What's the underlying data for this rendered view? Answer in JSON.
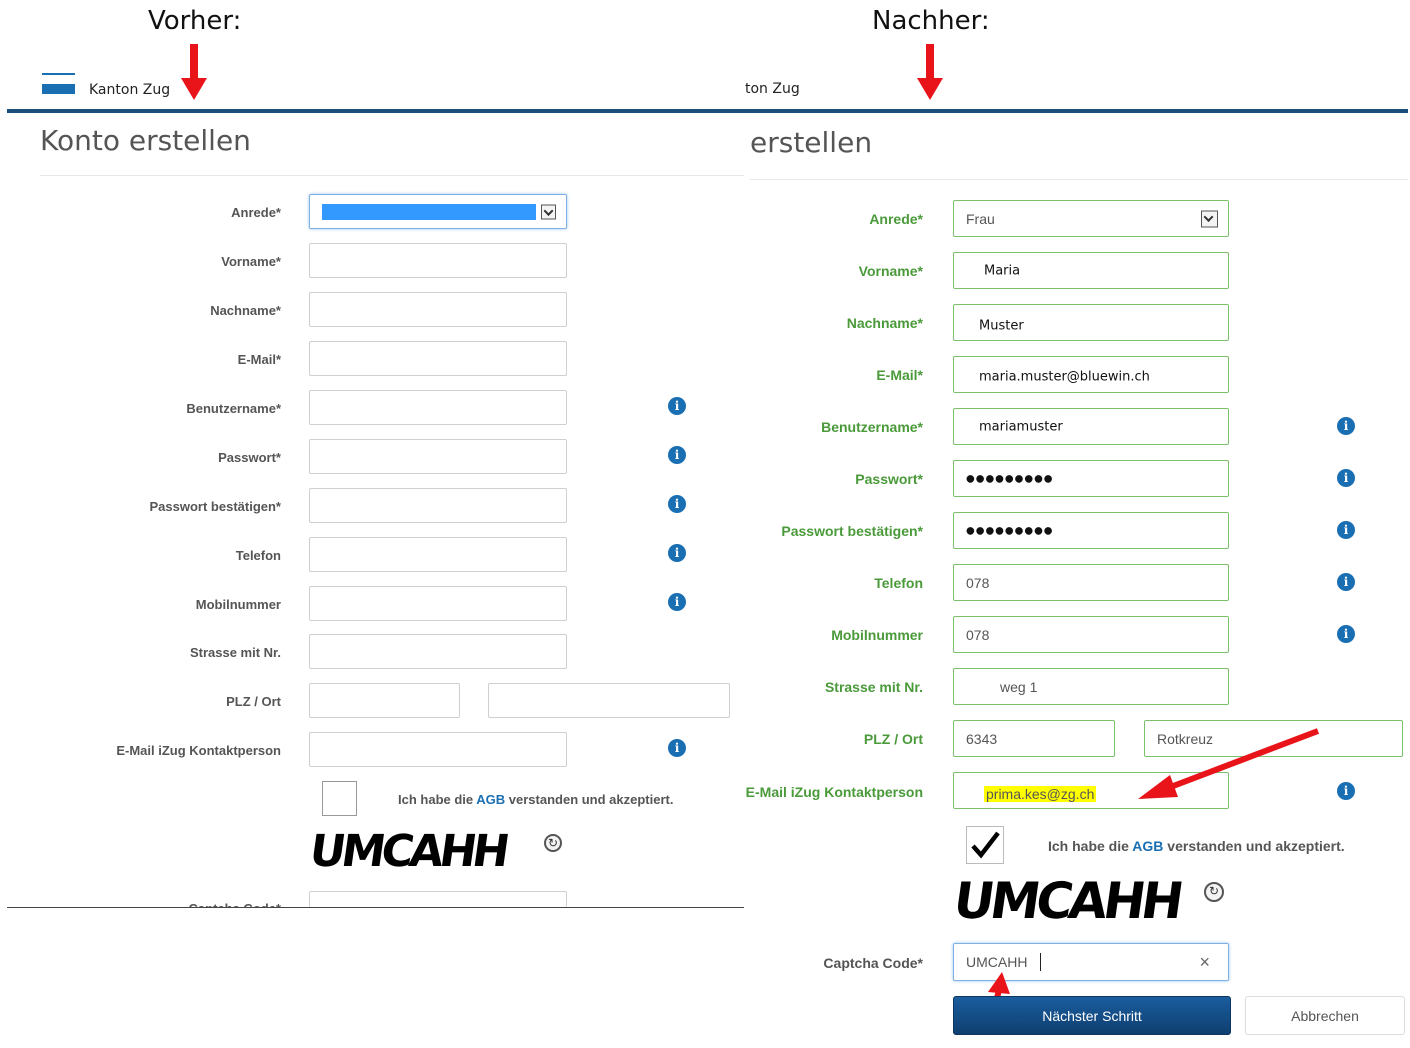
{
  "captions": {
    "before": "Vorher:",
    "after": "Nachher:"
  },
  "left": {
    "brand": "Kanton Zug",
    "title": "Konto erstellen",
    "labels": {
      "anrede": "Anrede*",
      "vorname": "Vorname*",
      "nachname": "Nachname*",
      "email": "E-Mail*",
      "benutzername": "Benutzername*",
      "passwort": "Passwort*",
      "passwort_bestaetigen": "Passwort bestätigen*",
      "telefon": "Telefon",
      "mobil": "Mobilnummer",
      "strasse": "Strasse mit Nr.",
      "plz_ort": "PLZ / Ort",
      "kontakt": "E-Mail iZug Kontaktperson",
      "captcha": "Captcha Code*"
    },
    "agb_prefix": "Ich habe die ",
    "agb_link": "AGB",
    "agb_suffix": " verstanden und akzeptiert.",
    "captcha_text": "UMCAHH"
  },
  "right": {
    "brand": "ton Zug",
    "title": "erstellen",
    "labels": {
      "anrede": "Anrede*",
      "vorname": "Vorname*",
      "nachname": "Nachname*",
      "email": "E-Mail*",
      "benutzername": "Benutzername*",
      "passwort": "Passwort*",
      "passwort_bestaetigen": "Passwort bestätigen*",
      "telefon": "Telefon",
      "mobil": "Mobilnummer",
      "strasse": "Strasse mit Nr.",
      "plz_ort": "PLZ / Ort",
      "kontakt": "E-Mail iZug Kontaktperson",
      "captcha": "Captcha Code*"
    },
    "values": {
      "anrede": "Frau",
      "vorname": "Maria",
      "nachname": "Muster",
      "email": "maria.muster@bluewin.ch",
      "benutzername": "mariamuster",
      "passwort": "●●●●●●●●●",
      "passwort_bestaetigen": "●●●●●●●●●",
      "telefon": "078",
      "mobil": "078",
      "strasse": "weg 1",
      "plz": "6343",
      "ort": "Rotkreuz",
      "kontakt": "prima.kes@zg.ch",
      "captcha": "UMCAHH"
    },
    "agb_prefix": "Ich habe die ",
    "agb_link": "AGB",
    "agb_suffix": " verstanden und akzeptiert.",
    "captcha_text": "UMCAHH",
    "clear_symbol": "×",
    "next_button": "Nächster Schritt",
    "cancel_button": "Abbrechen"
  },
  "colors": {
    "accent": "#1a6fb3",
    "valid": "#4a9a3a",
    "annotation": "#e8141a",
    "header_line": "#1b4f7a"
  }
}
